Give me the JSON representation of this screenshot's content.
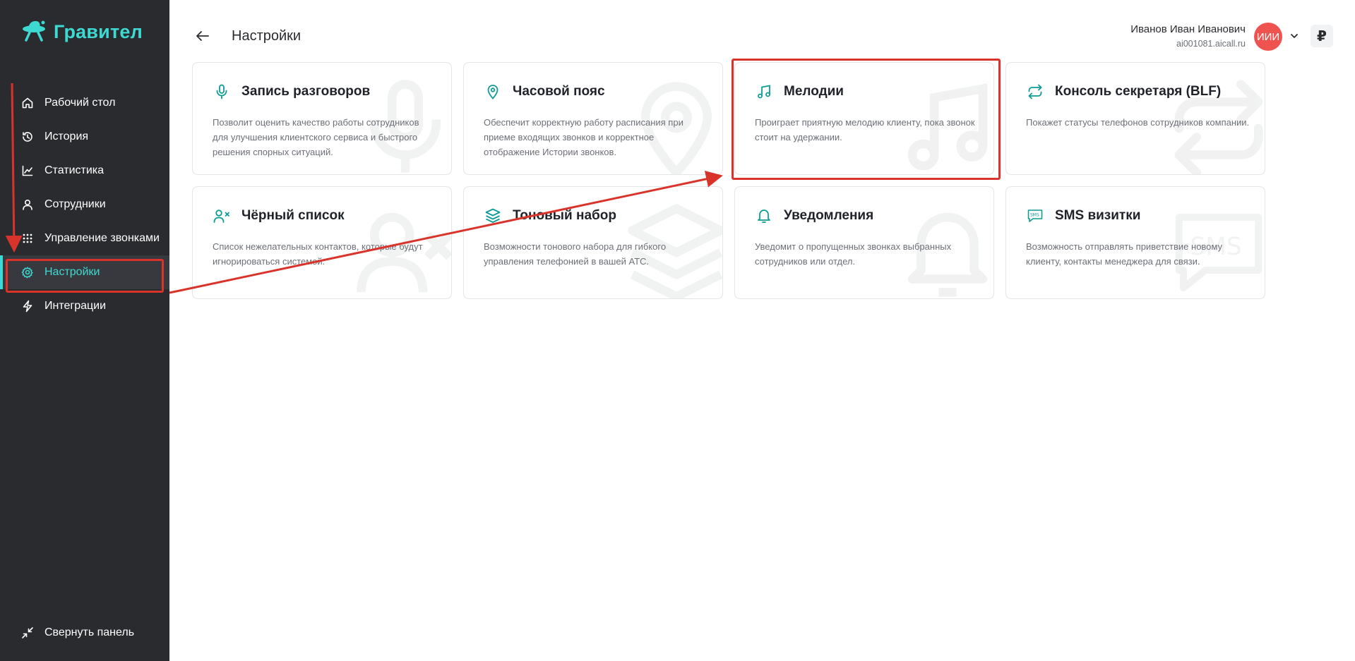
{
  "app": {
    "name": "Гравител"
  },
  "sidebar": {
    "items": [
      {
        "label": "Рабочий стол",
        "icon": "home-icon"
      },
      {
        "label": "История",
        "icon": "history-icon"
      },
      {
        "label": "Статистика",
        "icon": "chart-icon"
      },
      {
        "label": "Сотрудники",
        "icon": "user-icon"
      },
      {
        "label": "Управление звонками",
        "icon": "dialpad-icon"
      },
      {
        "label": "Настройки",
        "icon": "gear-icon",
        "active": true
      },
      {
        "label": "Интеграции",
        "icon": "lightning-icon"
      }
    ],
    "collapse_label": "Свернуть панель"
  },
  "header": {
    "title": "Настройки",
    "user_name": "Иванов Иван Иванович",
    "user_login": "ai001081.aicall.ru",
    "avatar_initials": "ИИИ",
    "currency_symbol": "₽"
  },
  "cards": [
    {
      "title": "Запись разговоров",
      "icon": "microphone-icon",
      "description": "Позволит оценить качество работы сотрудников для улучшения клиентского сервиса и быстрого решения спорных ситуаций."
    },
    {
      "title": "Часовой пояс",
      "icon": "map-pin-icon",
      "description": "Обеспечит корректную работу расписания при приеме входящих звонков и корректное отображение Истории звонков."
    },
    {
      "title": "Мелодии",
      "icon": "music-note-icon",
      "description": "Проиграет приятную мелодию клиенту, пока звонок стоит на удержании.",
      "highlighted": true
    },
    {
      "title": "Консоль секретаря (BLF)",
      "icon": "repeat-arrows-icon",
      "description": "Покажет статусы телефонов сотрудников компании."
    },
    {
      "title": "Чёрный список",
      "icon": "user-x-icon",
      "description": "Список нежелательных контактов, которые будут игнорироваться системой."
    },
    {
      "title": "Тоновый набор",
      "icon": "layers-icon",
      "description": "Возможности тонового набора для гибкого управления телефонией в вашей АТС."
    },
    {
      "title": "Уведомления",
      "icon": "bell-icon",
      "description": "Уведомит о пропущенных звонках выбранных сотрудников или отдел."
    },
    {
      "title": "SMS визитки",
      "icon": "sms-icon",
      "description": "Возможность отправлять приветствие новому клиенту, контакты менеджера для связи."
    }
  ],
  "colors": {
    "accent": "#3dd9d2",
    "sidebar_bg": "#2a2b2f",
    "icon_teal": "#0e9c95",
    "annotation_red": "#d9342b",
    "avatar_bg": "#ef5350"
  }
}
